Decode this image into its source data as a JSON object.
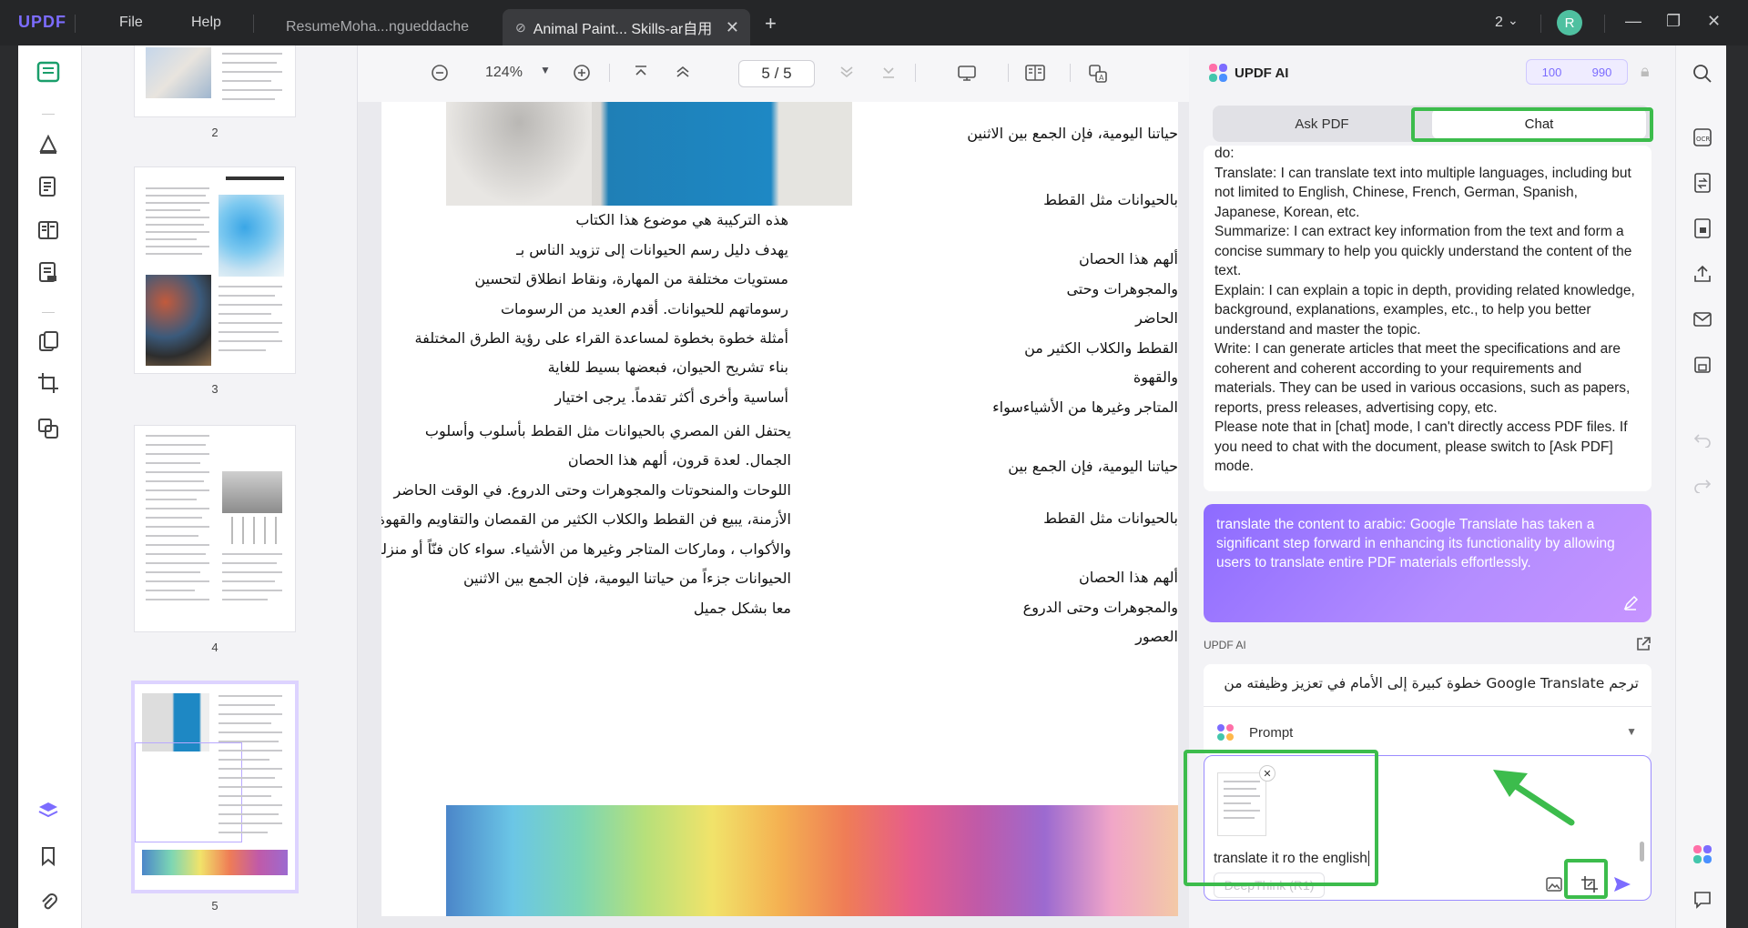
{
  "app": {
    "logo_text": "UPDF",
    "menu": [
      "File",
      "Help"
    ],
    "tabs": [
      {
        "label": "ResumeMoha...ngueddache"
      },
      {
        "label": "Animal Paint... Skills-ar自用"
      }
    ],
    "window_count": "2",
    "avatar_letter": "R",
    "accent_color": "#7c6cff"
  },
  "toolbar": {
    "zoom": "124%",
    "page_current": "5",
    "page_sep": "/",
    "page_total": "5"
  },
  "thumbnails": {
    "pages": [
      "2",
      "3",
      "4",
      "5"
    ],
    "selected": "5"
  },
  "document": {
    "right_column": [
      "حياتنا اليومية، فإن الجمع بين الاثنين",
      "بالحيوانات مثل القطط",
      "ألهم هذا الحصان",
      "والمجوهرات وحتى",
      "الحاضر",
      "القطط والكلاب الكثير من",
      "والقهوة",
      "المتاجر وغيرها من الأشياءسواء",
      "حياتنا اليومية، فإن الجمع بين",
      "بالحيوانات مثل القطط",
      "ألهم هذا الحصان",
      "والمجوهرات وحتى الدروع",
      "العصور"
    ],
    "left_column": [
      "هذه التركيبة هي موضوع هذا الكتاب",
      "يهدف دليل رسم الحيوانات إلى تزويد الناس بـ",
      "مستويات مختلفة من المهارة، ونقاط انطلاق لتحسين",
      "رسوماتهم للحيوانات. أقدم العديد من الرسومات",
      "أمثلة خطوة بخطوة لمساعدة القراء على رؤية الطرق المختلفة",
      "بناء تشريح الحيوان، فبعضها بسيط للغاية",
      "أساسية وأخرى أكثر تقدماً. يرجى اختيار",
      "يحتفل الفن المصري بالحيوانات مثل القطط بأسلوب وأسلوب",
      "الجمال. لعدة قرون، ألهم هذا الحصان",
      "اللوحات والمنحوتات والمجوهرات وحتى الدروع. في الوقت الحاضر",
      "الأزمنة، يبيع فن القطط والكلاب الكثير من القمصان والتقاويم والقهوة",
      "والأكواب ، وماركات المتاجر وغيرها من الأشياء. سواء كان فنّاً أو منزلنا",
      "الحيوانات جزءاً من حياتنا اليومية، فإن الجمع بين الاثنين",
      "معا بشكل جميل"
    ]
  },
  "ai_panel": {
    "title": "UPDF AI",
    "credits_a": "100",
    "credits_b": "990",
    "mode_ask": "Ask PDF",
    "mode_chat": "Chat",
    "answer_paragraphs": [
      "do:",
      "Translate: I can translate text into multiple languages, including but not limited to English, Chinese, French, German, Spanish, Japanese, Korean, etc.",
      "Summarize: I can extract key information from the text and form a concise summary to help you quickly understand the content of the text.",
      "Explain: I can explain a topic in depth, providing related knowledge, background, explanations, examples, etc., to help you better understand and master the topic.",
      "Write: I can generate articles that meet the specifications and are coherent and coherent according to your requirements and materials. They can be used in various occasions, such as papers, reports, press releases, advertising copy, etc.",
      "Please note that in [chat] mode, I can't directly access PDF files. If you need to chat with the document, please switch to [Ask PDF] mode."
    ],
    "user_message": "translate the content to arabic: Google Translate has taken a significant step forward in enhancing its functionality by allowing users to translate entire PDF materials effortlessly.",
    "reply_label": "UPDF AI",
    "reply_preview": "ترجم Google Translate خطوة كبيرة إلى الأمام في تعزيز وظيفته من",
    "prompt_label": "Prompt",
    "input_value": "translate it ro the english",
    "deepthink_label": "DeepThink (R1)",
    "highlight_color": "#3cbc4c"
  }
}
